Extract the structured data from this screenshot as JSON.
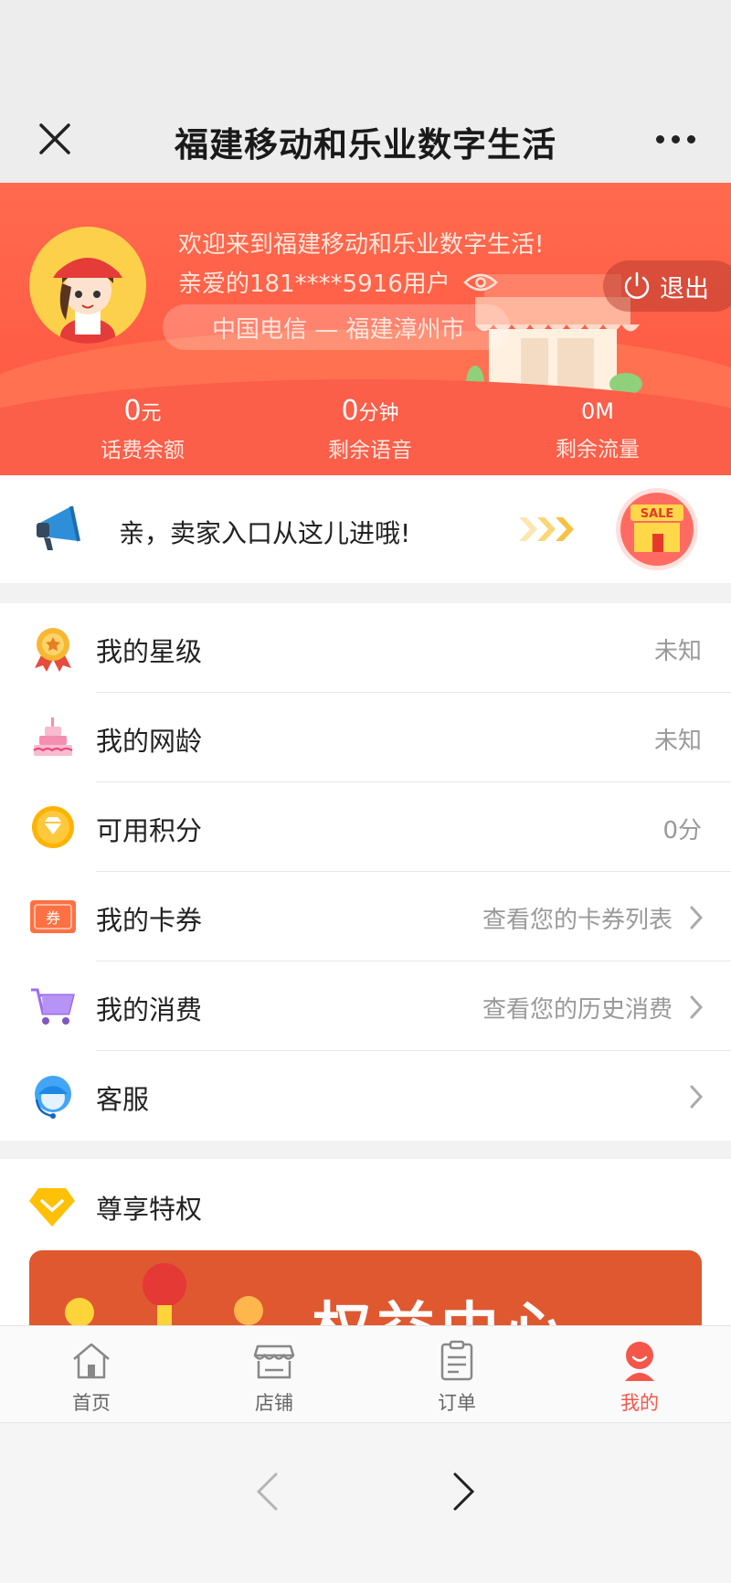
{
  "titlebar": {
    "title": "福建移动和乐业数字生活"
  },
  "header": {
    "welcome": "欢迎来到福建移动和乐业数字生活!",
    "user": "亲爱的181****5916用户",
    "region": "中国电信 — 福建漳州市",
    "logout_label": "退出",
    "stats": [
      {
        "value": "0",
        "unit": "元",
        "label": "话费余额"
      },
      {
        "value": "0",
        "unit": "分钟",
        "label": "剩余语音"
      },
      {
        "value": "0M",
        "unit": "",
        "label": "剩余流量"
      }
    ]
  },
  "seller": {
    "text": "亲，卖家入口从这儿进哦!",
    "badge": "SALE"
  },
  "list": [
    {
      "label": "我的星级",
      "value": "未知",
      "icon": "medal-icon"
    },
    {
      "label": "我的网龄",
      "value": "未知",
      "icon": "cake-icon"
    },
    {
      "label": "可用积分",
      "value": "0分",
      "icon": "diamond-coin-icon"
    },
    {
      "label": "我的卡券",
      "value": "查看您的卡券列表",
      "icon": "coupon-icon",
      "coupon_text": "券"
    },
    {
      "label": "我的消费",
      "value": "查看您的历史消费",
      "icon": "cart-icon"
    },
    {
      "label": "客服",
      "value": "",
      "icon": "customer-service-icon"
    }
  ],
  "privileges": {
    "label": "尊享特权",
    "banner_text": "权益中心"
  },
  "tabbar": [
    {
      "label": "首页",
      "icon": "home-icon"
    },
    {
      "label": "店铺",
      "icon": "store-icon"
    },
    {
      "label": "订单",
      "icon": "order-icon"
    },
    {
      "label": "我的",
      "icon": "profile-icon",
      "active": true
    }
  ],
  "colors": {
    "brand": "#ff5d45",
    "active_tab": "#f4574a"
  }
}
